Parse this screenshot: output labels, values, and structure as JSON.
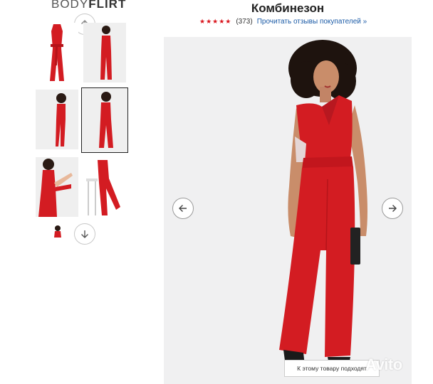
{
  "brand": {
    "light": "BODY",
    "bold": "FLIRT"
  },
  "product": {
    "title": "Комбинезон",
    "stars": "★★★★★",
    "review_count": "(373)",
    "reviews_link": "Прочитать отзывы покупателей »",
    "rating_color": "#d9141c",
    "accent_color": "#d31c22"
  },
  "gallery": {
    "scroll_up_icon": "chevron-up-icon",
    "scroll_down_icon": "chevron-down-icon",
    "prev_icon": "arrow-left-icon",
    "next_icon": "arrow-right-icon",
    "selected_index": 3
  },
  "to_product_label": "К этому товару подходят",
  "watermark": "Avito"
}
